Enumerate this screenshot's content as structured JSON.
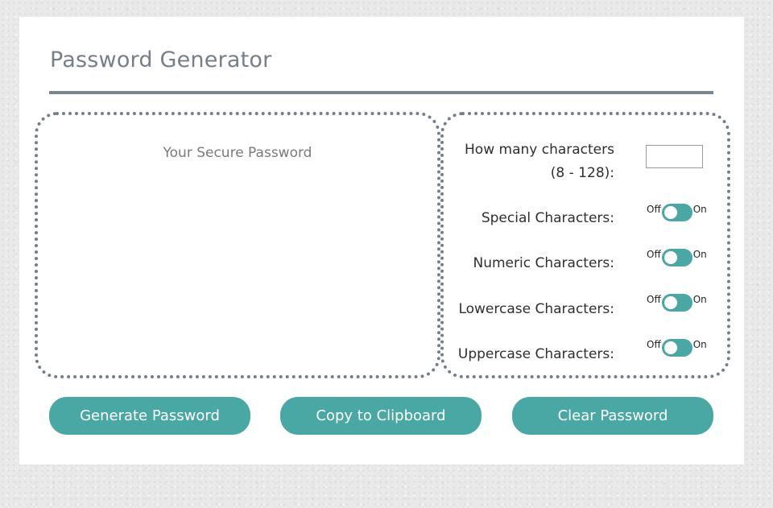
{
  "header": {
    "title": "Password Generator"
  },
  "password_panel": {
    "placeholder": "Your Secure Password"
  },
  "options": {
    "length": {
      "label_line1": "How many characters",
      "label_line2": "(8 - 128):",
      "value": ""
    },
    "toggles": [
      {
        "label": "Special Characters:",
        "off_label": "Off",
        "on_label": "On"
      },
      {
        "label": "Numeric Characters:",
        "off_label": "Off",
        "on_label": "On"
      },
      {
        "label": "Lowercase Characters:",
        "off_label": "Off",
        "on_label": "On"
      },
      {
        "label": "Uppercase Characters:",
        "off_label": "Off",
        "on_label": "On"
      }
    ]
  },
  "buttons": {
    "generate": "Generate Password",
    "copy": "Copy to Clipboard",
    "clear": "Clear Password"
  },
  "colors": {
    "accent": "#4aa8a4",
    "title": "#757f89",
    "border": "#727e8a"
  }
}
